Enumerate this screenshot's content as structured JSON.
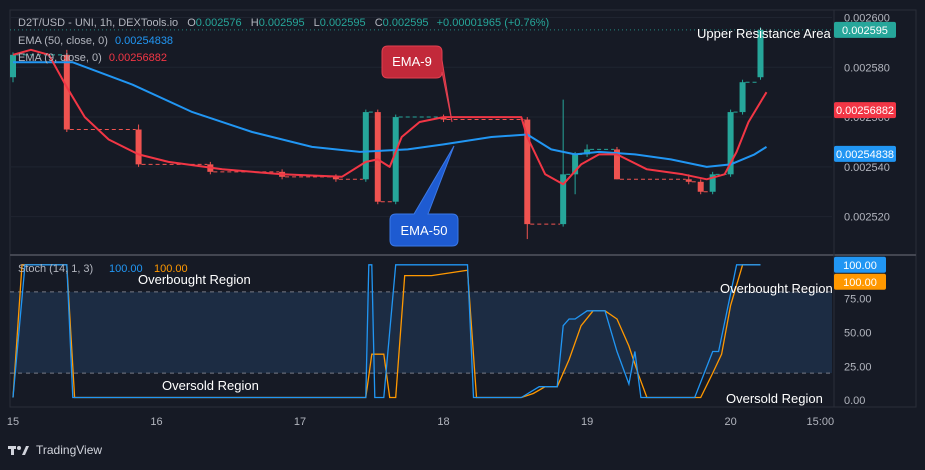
{
  "header": {
    "symbol_line": "D2T/USD - UNI, 1h, DEXTools.io",
    "ohlc": [
      {
        "k": "O",
        "v": "0.002576"
      },
      {
        "k": "H",
        "v": "0.002595"
      },
      {
        "k": "L",
        "v": "0.002595"
      },
      {
        "k": "C",
        "v": "0.002595"
      }
    ],
    "change": "+0.00001965 (+0.76%)",
    "ema50_label": "EMA (50, close, 0)",
    "ema50_value": "0.00254838",
    "ema9_label": "EMA (9, close, 0)",
    "ema9_value": "0.00256882"
  },
  "colors": {
    "background": "#161a25",
    "up": "#26a69a",
    "down": "#ef5350",
    "ema50": "#2196f3",
    "ema9": "#f23645",
    "stoch_k": "#2196f3",
    "stoch_d": "#ff9800",
    "callout_red": "#c2293a",
    "callout_blue": "#1e5bd1"
  },
  "chart_data": {
    "type": "candlestick",
    "price_axis": {
      "ylim": [
        0.002505,
        0.002603
      ],
      "ticks": [
        0.00252,
        0.00254,
        0.00256,
        0.00258,
        0.0026
      ],
      "tick_labels": [
        "0.002520",
        "0.002540",
        "0.002560",
        "0.002580",
        "0.002600"
      ]
    },
    "x_axis": {
      "labels": [
        "15",
        "16",
        "17",
        "18",
        "19",
        "20",
        "15:00"
      ],
      "values": [
        0,
        24,
        48,
        72,
        96,
        120,
        135
      ]
    },
    "candles": [
      {
        "t": 0,
        "o": 0.002576,
        "h": 0.002586,
        "l": 0.002574,
        "c": 0.002585
      },
      {
        "t": 9,
        "o": 0.002585,
        "h": 0.002587,
        "l": 0.002554,
        "c": 0.002555
      },
      {
        "t": 21,
        "o": 0.002555,
        "h": 0.002557,
        "l": 0.00254,
        "c": 0.002541
      },
      {
        "t": 33,
        "o": 0.002541,
        "h": 0.002542,
        "l": 0.002537,
        "c": 0.002538
      },
      {
        "t": 45,
        "o": 0.002538,
        "h": 0.002539,
        "l": 0.002535,
        "c": 0.002536
      },
      {
        "t": 54,
        "o": 0.002536,
        "h": 0.002537,
        "l": 0.002534,
        "c": 0.002535
      },
      {
        "t": 59,
        "o": 0.002535,
        "h": 0.002563,
        "l": 0.002534,
        "c": 0.002562
      },
      {
        "t": 61,
        "o": 0.002562,
        "h": 0.002563,
        "l": 0.002525,
        "c": 0.002526
      },
      {
        "t": 64,
        "o": 0.002526,
        "h": 0.002561,
        "l": 0.002525,
        "c": 0.00256
      },
      {
        "t": 72,
        "o": 0.00256,
        "h": 0.002561,
        "l": 0.002558,
        "c": 0.002559
      },
      {
        "t": 86,
        "o": 0.002559,
        "h": 0.00256,
        "l": 0.002511,
        "c": 0.002517
      },
      {
        "t": 92,
        "o": 0.002517,
        "h": 0.002567,
        "l": 0.002516,
        "c": 0.002537
      },
      {
        "t": 94,
        "o": 0.002537,
        "h": 0.002546,
        "l": 0.002529,
        "c": 0.002545
      },
      {
        "t": 96,
        "o": 0.002545,
        "h": 0.002549,
        "l": 0.002544,
        "c": 0.002547
      },
      {
        "t": 101,
        "o": 0.002547,
        "h": 0.002548,
        "l": 0.002535,
        "c": 0.002535
      },
      {
        "t": 113,
        "o": 0.002535,
        "h": 0.002537,
        "l": 0.002533,
        "c": 0.002534
      },
      {
        "t": 115,
        "o": 0.002534,
        "h": 0.002535,
        "l": 0.002529,
        "c": 0.00253
      },
      {
        "t": 117,
        "o": 0.00253,
        "h": 0.002538,
        "l": 0.002529,
        "c": 0.002537
      },
      {
        "t": 120,
        "o": 0.002537,
        "h": 0.002563,
        "l": 0.002536,
        "c": 0.002562
      },
      {
        "t": 122,
        "o": 0.002562,
        "h": 0.002575,
        "l": 0.002561,
        "c": 0.002574
      },
      {
        "t": 125,
        "o": 0.002576,
        "h": 0.002596,
        "l": 0.002575,
        "c": 0.002595
      }
    ],
    "ema9": [
      [
        0,
        0.002585
      ],
      [
        3,
        0.002587
      ],
      [
        6,
        0.002585
      ],
      [
        9,
        0.002572
      ],
      [
        12,
        0.00256
      ],
      [
        16,
        0.002551
      ],
      [
        21,
        0.002545
      ],
      [
        26,
        0.002542
      ],
      [
        35,
        0.002539
      ],
      [
        45,
        0.002537
      ],
      [
        55,
        0.002536
      ],
      [
        59,
        0.002542
      ],
      [
        61,
        0.002543
      ],
      [
        63,
        0.00254
      ],
      [
        65,
        0.002552
      ],
      [
        68,
        0.002558
      ],
      [
        72,
        0.00256
      ],
      [
        80,
        0.00256
      ],
      [
        85,
        0.00256
      ],
      [
        86,
        0.002552
      ],
      [
        89,
        0.002537
      ],
      [
        92,
        0.002533
      ],
      [
        95,
        0.002541
      ],
      [
        98,
        0.002545
      ],
      [
        101,
        0.002545
      ],
      [
        106,
        0.002539
      ],
      [
        112,
        0.002537
      ],
      [
        116,
        0.002535
      ],
      [
        119,
        0.002537
      ],
      [
        121,
        0.002546
      ],
      [
        123,
        0.002558
      ],
      [
        125,
        0.002566
      ],
      [
        126,
        0.00257
      ]
    ],
    "ema50": [
      [
        0,
        0.002582
      ],
      [
        10,
        0.002582
      ],
      [
        20,
        0.002573
      ],
      [
        30,
        0.002562
      ],
      [
        40,
        0.002554
      ],
      [
        50,
        0.002548
      ],
      [
        58,
        0.002546
      ],
      [
        66,
        0.002547
      ],
      [
        72,
        0.002549
      ],
      [
        80,
        0.002552
      ],
      [
        86,
        0.002553
      ],
      [
        90,
        0.002547
      ],
      [
        94,
        0.002545
      ],
      [
        98,
        0.002546
      ],
      [
        104,
        0.002545
      ],
      [
        110,
        0.002543
      ],
      [
        116,
        0.00254
      ],
      [
        120,
        0.002541
      ],
      [
        124,
        0.002545
      ],
      [
        126,
        0.002548
      ]
    ],
    "value_tags": [
      {
        "label": "0.002595",
        "value": 0.002595,
        "color": "#26a69a"
      },
      {
        "label": "0.00256882",
        "value": 0.0025628,
        "color": "#f23645"
      },
      {
        "label": "0.00254838",
        "value": 0.0025452,
        "color": "#2196f3"
      }
    ],
    "annotations": {
      "upper_resistance": "Upper Resistance Area",
      "ema9_callout": "EMA-9",
      "ema50_callout": "EMA-50"
    },
    "stoch": {
      "label": "Stoch (14, 1, 3)",
      "k_value": "100.00",
      "d_value": "100.00",
      "ylim": [
        -5,
        105
      ],
      "ticks": [
        0,
        25,
        50,
        75
      ],
      "tick_labels": [
        "0.00",
        "25.00",
        "50.00",
        "75.00"
      ],
      "overbought_level": 80,
      "oversold_level": 20,
      "overbought_text": "Overbought Region",
      "oversold_text": "Oversold Region",
      "k": [
        [
          0,
          2
        ],
        [
          2,
          100
        ],
        [
          9,
          100
        ],
        [
          10,
          2
        ],
        [
          59,
          2
        ],
        [
          59.5,
          100
        ],
        [
          60,
          100
        ],
        [
          60.5,
          2
        ],
        [
          61,
          2
        ],
        [
          62,
          2
        ],
        [
          64,
          100
        ],
        [
          68,
          100
        ],
        [
          70,
          100
        ],
        [
          76,
          100
        ],
        [
          77,
          2
        ],
        [
          85,
          2
        ],
        [
          88,
          10
        ],
        [
          91,
          10
        ],
        [
          92,
          55
        ],
        [
          93,
          60
        ],
        [
          94,
          60
        ],
        [
          96,
          66
        ],
        [
          99,
          66
        ],
        [
          101,
          36
        ],
        [
          103,
          12
        ],
        [
          104,
          36
        ],
        [
          105,
          2
        ],
        [
          114,
          2
        ],
        [
          117,
          36
        ],
        [
          118,
          36
        ],
        [
          121,
          100
        ],
        [
          125,
          100
        ]
      ],
      "d": [
        [
          0,
          2
        ],
        [
          1.5,
          100
        ],
        [
          9,
          100
        ],
        [
          10.3,
          2
        ],
        [
          59,
          2
        ],
        [
          60,
          34
        ],
        [
          61.5,
          34
        ],
        [
          62,
          34
        ],
        [
          63,
          2
        ],
        [
          64,
          2
        ],
        [
          65.5,
          92
        ],
        [
          70,
          92
        ],
        [
          76,
          96
        ],
        [
          77.5,
          2
        ],
        [
          85,
          2
        ],
        [
          87,
          5
        ],
        [
          89,
          10
        ],
        [
          91,
          10
        ],
        [
          93,
          30
        ],
        [
          95,
          55
        ],
        [
          97,
          66
        ],
        [
          99,
          66
        ],
        [
          101,
          60
        ],
        [
          103,
          40
        ],
        [
          104.5,
          20
        ],
        [
          106,
          2
        ],
        [
          115,
          2
        ],
        [
          117,
          20
        ],
        [
          118.5,
          34
        ],
        [
          120,
          70
        ],
        [
          122,
          100
        ],
        [
          125,
          100
        ]
      ]
    }
  },
  "footer": {
    "brand": "TradingView"
  }
}
